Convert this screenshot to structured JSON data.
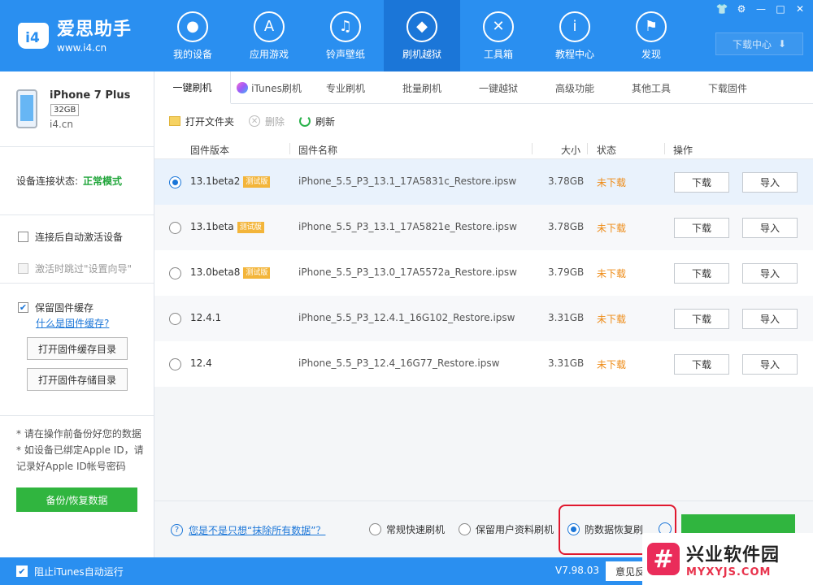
{
  "brand": {
    "name": "爱思助手",
    "url": "www.i4.cn"
  },
  "nav": [
    {
      "label": "我的设备",
      "icon": "apple-icon",
      "glyph": ""
    },
    {
      "label": "应用游戏",
      "icon": "app-store-icon",
      "glyph": "A"
    },
    {
      "label": "铃声壁纸",
      "icon": "music-icon",
      "glyph": "♫"
    },
    {
      "label": "刷机越狱",
      "icon": "dropbox-icon",
      "glyph": "◆"
    },
    {
      "label": "工具箱",
      "icon": "tools-icon",
      "glyph": "✕"
    },
    {
      "label": "教程中心",
      "icon": "info-icon",
      "glyph": "i"
    },
    {
      "label": "发现",
      "icon": "flag-icon",
      "glyph": "⚑"
    }
  ],
  "window": {
    "download_center": "下载中心"
  },
  "device": {
    "name": "iPhone 7 Plus",
    "capacity": "32GB",
    "site": "i4.cn"
  },
  "connection": {
    "label": "设备连接状态:",
    "value": "正常模式"
  },
  "options": {
    "auto_activate": "连接后自动激活设备",
    "skip_setup": "激活时跳过\"设置向导\""
  },
  "cache": {
    "keep_label": "保留固件缓存",
    "what_link": "什么是固件缓存?",
    "open_cache_dir": "打开固件缓存目录",
    "open_store_dir": "打开固件存储目录"
  },
  "notes": {
    "line1": "* 请在操作前备份好您的数据",
    "line2": "* 如设备已绑定Apple ID，请",
    "line3": "记录好Apple ID帐号密码"
  },
  "backup_button": "备份/恢复数据",
  "tabs": [
    "一键刷机",
    "iTunes刷机",
    "专业刷机",
    "批量刷机",
    "一键越狱",
    "高级功能",
    "其他工具",
    "下载固件"
  ],
  "toolbar": {
    "open_folder": "打开文件夹",
    "delete": "删除",
    "refresh": "刷新"
  },
  "table": {
    "headers": {
      "version": "固件版本",
      "name": "固件名称",
      "size": "大小",
      "status": "状态",
      "action": "操作"
    },
    "rows": [
      {
        "version": "13.1beta2",
        "beta": "测试版",
        "name": "iPhone_5.5_P3_13.1_17A5831c_Restore.ipsw",
        "size": "3.78GB",
        "status": "未下载",
        "download": "下载",
        "import": "导入"
      },
      {
        "version": "13.1beta",
        "beta": "测试版",
        "name": "iPhone_5.5_P3_13.1_17A5821e_Restore.ipsw",
        "size": "3.78GB",
        "status": "未下载",
        "download": "下载",
        "import": "导入"
      },
      {
        "version": "13.0beta8",
        "beta": "测试版",
        "name": "iPhone_5.5_P3_13.0_17A5572a_Restore.ipsw",
        "size": "3.79GB",
        "status": "未下载",
        "download": "下载",
        "import": "导入"
      },
      {
        "version": "12.4.1",
        "beta": "",
        "name": "iPhone_5.5_P3_12.4.1_16G102_Restore.ipsw",
        "size": "3.31GB",
        "status": "未下载",
        "download": "下载",
        "import": "导入"
      },
      {
        "version": "12.4",
        "beta": "",
        "name": "iPhone_5.5_P3_12.4_16G77_Restore.ipsw",
        "size": "3.31GB",
        "status": "未下载",
        "download": "下载",
        "import": "导入"
      }
    ]
  },
  "bottom": {
    "question": "您是不是只想“抹除所有数据”？",
    "mode_fast": "常规快速刷机",
    "mode_keep": "保留用户资料刷机",
    "mode_anti": "防数据恢复刷"
  },
  "statusbar": {
    "block_itunes": "阻止iTunes自动运行",
    "version": "V7.98.03",
    "feedback": "意见反"
  },
  "watermark": {
    "title": "兴业软件园",
    "url": "MYXYJS.COM"
  },
  "colors": {
    "primary": "#2a8ff0",
    "active_nav": "#1b76d8",
    "green": "#30b53f",
    "status_orange": "#ee8b16",
    "highlight_red": "#e0182e"
  }
}
